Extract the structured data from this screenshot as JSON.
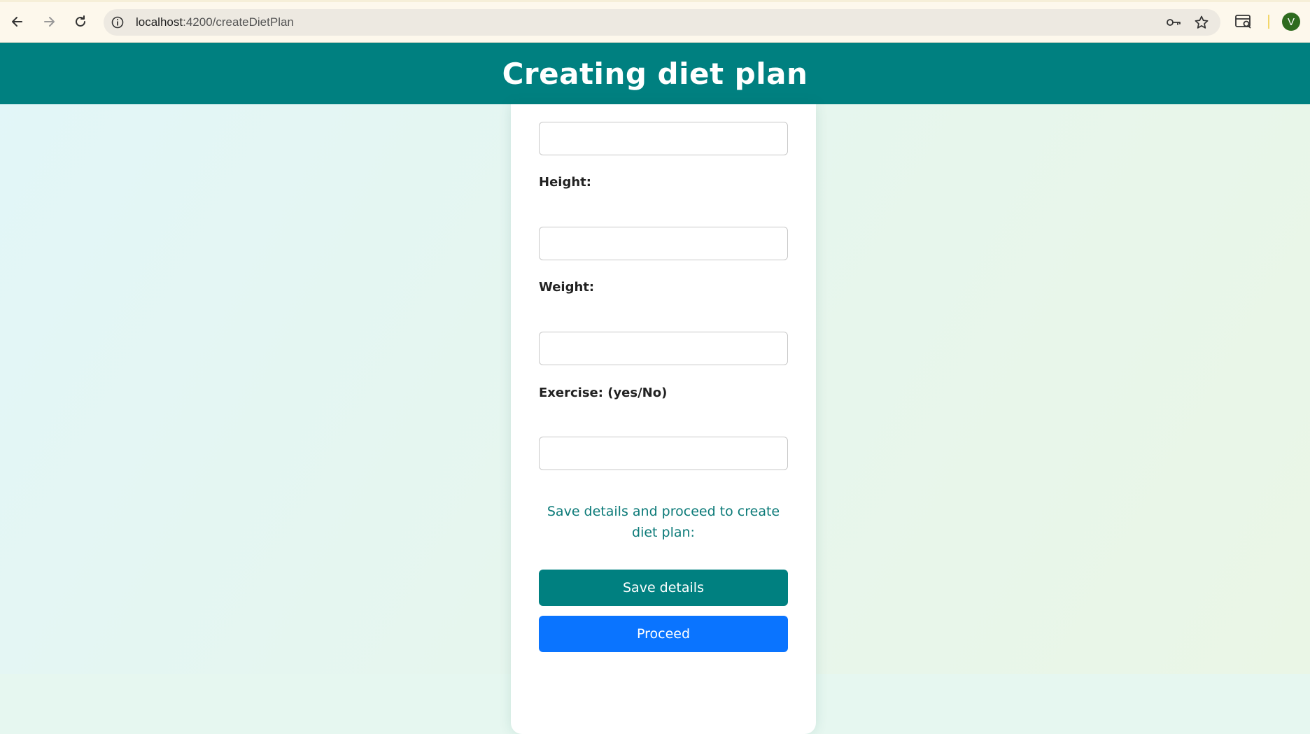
{
  "browser": {
    "url_host": "localhost",
    "url_path": ":4200/createDietPlan",
    "profile_initial": "V",
    "icons": {
      "back": "arrow-left-icon",
      "forward": "arrow-right-icon",
      "reload": "reload-icon",
      "info": "info-icon",
      "password": "key-icon",
      "bookmark": "star-icon",
      "extensions": "tab-search-icon"
    }
  },
  "header": {
    "title": "Creating diet plan"
  },
  "form": {
    "top_field_value": "",
    "height_label": "Height:",
    "height_value": "",
    "weight_label": "Weight:",
    "weight_value": "",
    "exercise_label": "Exercise: (yes/No)",
    "exercise_value": "",
    "note": "Save details and proceed to create diet plan:",
    "save_label": "Save details",
    "proceed_label": "Proceed"
  },
  "colors": {
    "header": "#008080",
    "save_button": "#008080",
    "proceed_button": "#0a74ff",
    "note_text": "#0b7a78"
  }
}
